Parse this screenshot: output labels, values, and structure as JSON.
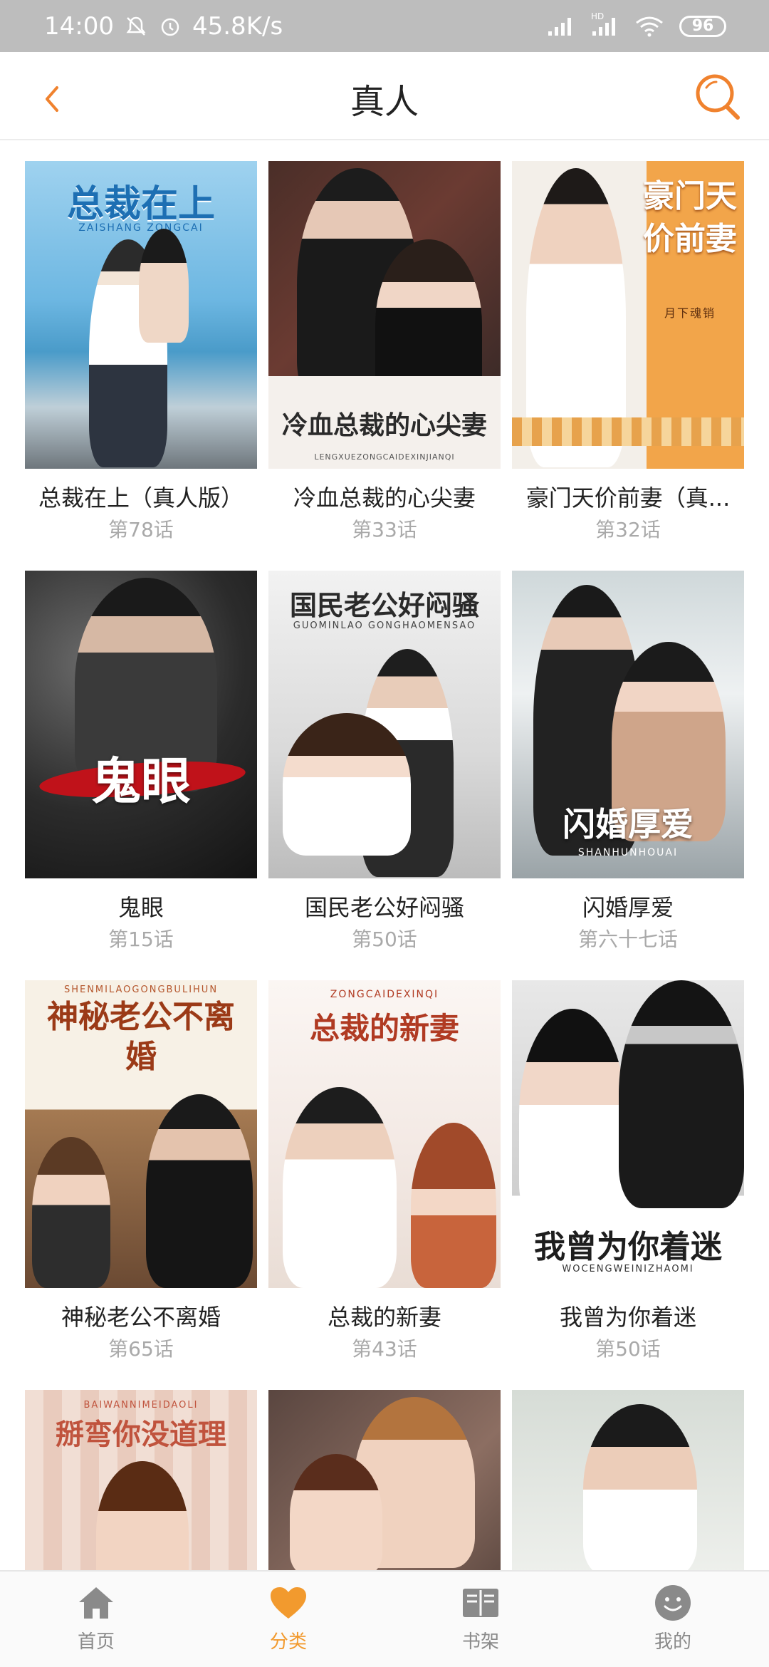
{
  "status_bar": {
    "time": "14:00",
    "speed": "45.8K/s",
    "battery": "96",
    "network_label": "HD"
  },
  "header": {
    "title": "真人",
    "back_icon": "chevron-left-icon",
    "search_icon": "search-icon",
    "accent_color": "#f0822e"
  },
  "books": [
    {
      "name": "总裁在上（真人版）",
      "episode": "第78话",
      "cover_title": "总裁在上",
      "cover_sub": "ZAISHANG ZONGCAI"
    },
    {
      "name": "冷血总裁的心尖妻",
      "episode": "第33话",
      "cover_title": "冷血总裁的心尖妻",
      "cover_sub": "LENGXUEZONGCAIDEXINJIANQI"
    },
    {
      "name": "豪门天价前妻（真...",
      "episode": "第32话",
      "cover_title": "豪门天价前妻",
      "cover_sub": "月下魂销"
    },
    {
      "name": "鬼眼",
      "episode": "第15话",
      "cover_title": "鬼眼",
      "cover_sub": ""
    },
    {
      "name": "国民老公好闷骚",
      "episode": "第50话",
      "cover_title": "国民老公好闷骚",
      "cover_sub": "GUOMINLAO GONGHAOMENSAO"
    },
    {
      "name": "闪婚厚爱",
      "episode": "第六十七话",
      "cover_title": "闪婚厚爱",
      "cover_sub": "SHANHUNHOUAI"
    },
    {
      "name": "神秘老公不离婚",
      "episode": "第65话",
      "cover_title": "神秘老公不离婚",
      "cover_sub": "SHENMILAOGONGBULIHUN"
    },
    {
      "name": "总裁的新妻",
      "episode": "第43话",
      "cover_title": "总裁的新妻",
      "cover_sub": "ZONGCAIDEXINQI"
    },
    {
      "name": "我曾为你着迷",
      "episode": "第50话",
      "cover_title": "我曾为你着迷",
      "cover_sub": "WOCENGWEINIZHAOMI"
    },
    {
      "name": "",
      "episode": "",
      "cover_title": "掰弯你没道理",
      "cover_sub": "BAIWANNIMEIDAOLI"
    },
    {
      "name": "",
      "episode": "",
      "cover_title": "",
      "cover_sub": ""
    },
    {
      "name": "",
      "episode": "",
      "cover_title": "",
      "cover_sub": ""
    }
  ],
  "bottom_nav": [
    {
      "label": "首页",
      "icon": "home-icon",
      "active": false
    },
    {
      "label": "分类",
      "icon": "heart-icon",
      "active": true
    },
    {
      "label": "书架",
      "icon": "bookshelf-icon",
      "active": false
    },
    {
      "label": "我的",
      "icon": "smiley-icon",
      "active": false
    }
  ]
}
